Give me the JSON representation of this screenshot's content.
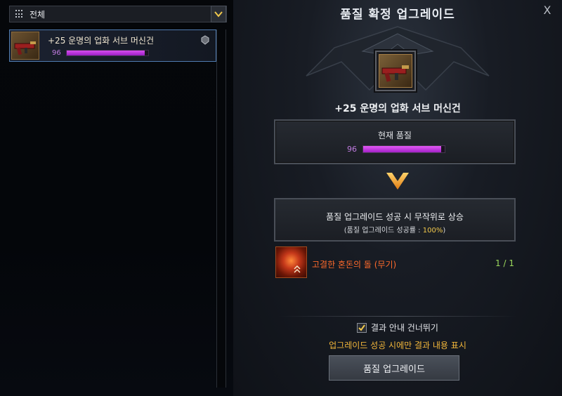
{
  "filter": {
    "label": "전체",
    "icon": "grid-icon",
    "dropdown_icon": "chevron-down-icon"
  },
  "list": {
    "items": [
      {
        "name": "+25 운명의 업화 서브 머신건",
        "quality": "96",
        "quality_fraction": 0.96,
        "badge_icon": "equipped-icon"
      }
    ]
  },
  "dialog": {
    "title": "품질 확정 업그레이드",
    "close_label": "X",
    "item_name": "+25 운명의 업화 서브 머신건",
    "current_quality_label": "현재 품질",
    "current_quality_value": "96",
    "current_quality_fraction": 0.96,
    "info_line1": "품질 업그레이드 성공 시 무작위로 상승",
    "info_line2_prefix": "(품질 업그레이드 성공률 : ",
    "info_line2_pct": "100%",
    "info_line2_suffix": ")",
    "material_name": "고결한 혼돈의 돌 (무기)",
    "material_count": "1 / 1",
    "skip_label": "결과 안내 건너뛰기",
    "skip_checked": true,
    "notice": "업그레이드 성공 시에만 결과 내용 표시",
    "upgrade_button": "품질 업그레이드"
  },
  "colors": {
    "quality_purple": "#c07be0",
    "material_orange": "#ff6a2b",
    "count_green": "#9bd85c",
    "notice_gold": "#f2b63a",
    "selection_blue": "#4f7bb0"
  }
}
